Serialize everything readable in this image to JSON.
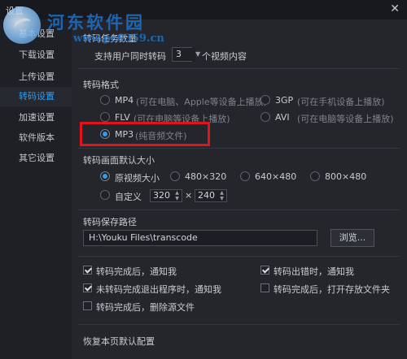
{
  "window": {
    "title": "设置",
    "close_glyph": "✕"
  },
  "watermark": {
    "name": "河东软件园",
    "url": "www.pc0359.cn"
  },
  "sidebar": {
    "items": [
      {
        "label": "基本设置",
        "active": false
      },
      {
        "label": "下载设置",
        "active": false
      },
      {
        "label": "上传设置",
        "active": false
      },
      {
        "label": "转码设置",
        "active": true
      },
      {
        "label": "加速设置",
        "active": false
      },
      {
        "label": "软件版本",
        "active": false
      },
      {
        "label": "其它设置",
        "active": false
      }
    ]
  },
  "task_count": {
    "title": "转码任务数量",
    "prefix": "支持用户同时转码",
    "value": "3",
    "suffix": "个视频内容"
  },
  "format": {
    "title": "转码格式",
    "options": [
      {
        "name": "MP4",
        "desc": "(可在电脑、Apple等设备上播放)",
        "checked": false
      },
      {
        "name": "3GP",
        "desc": "(可在手机设备上播放)",
        "checked": false
      },
      {
        "name": "FLV",
        "desc": "(可在电脑等设备上播放)",
        "checked": false
      },
      {
        "name": "AVI",
        "desc": "(可在电脑等设备上播放)",
        "checked": false
      },
      {
        "name": "MP3",
        "desc": "(纯音频文件)",
        "checked": true
      }
    ]
  },
  "size": {
    "title": "转码画面默认大小",
    "options": [
      {
        "label": "原视频大小",
        "checked": true
      },
      {
        "label": "480×320",
        "checked": false
      },
      {
        "label": "640×480",
        "checked": false
      },
      {
        "label": "800×480",
        "checked": false
      }
    ],
    "custom_label": "自定义",
    "custom_width": "320",
    "custom_times": "×",
    "custom_height": "240"
  },
  "save_path": {
    "title": "转码保存路径",
    "value": "H:\\Youku Files\\transcode",
    "browse_label": "浏览..."
  },
  "notifications": [
    {
      "label": "转码完成后，通知我",
      "checked": true
    },
    {
      "label": "转码出错时，通知我",
      "checked": true
    },
    {
      "label": "未转码完成退出程序时，通知我",
      "checked": true
    },
    {
      "label": "转码完成后，打开存放文件夹",
      "checked": false
    },
    {
      "label": "转码完成后，删除源文件",
      "checked": false
    }
  ],
  "restore_label": "恢复本页默认配置",
  "colors": {
    "accent": "#2f9cf0",
    "highlight": "#e0141b",
    "watermark": "#1f72c8"
  }
}
